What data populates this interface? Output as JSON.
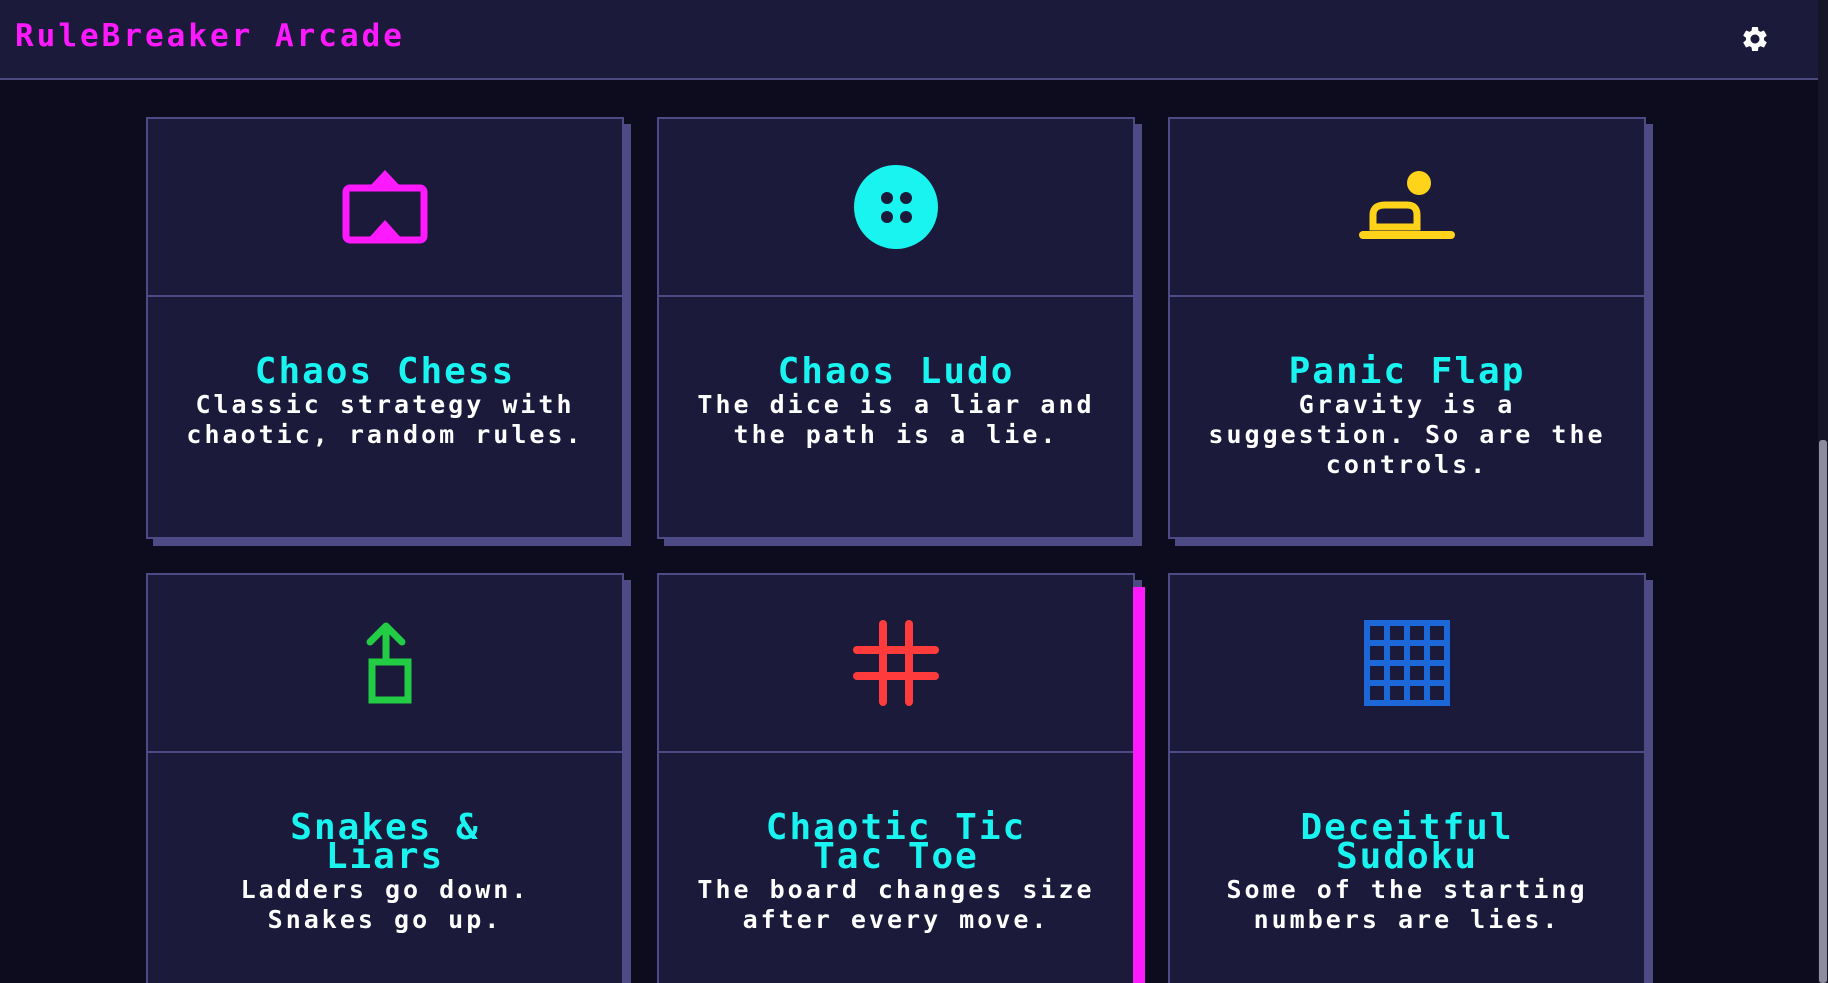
{
  "header": {
    "title": "RuleBreaker Arcade",
    "settings_icon": "gear-icon"
  },
  "colors": {
    "header_bg": "#1b1a3a",
    "page_bg": "#0c0c1e",
    "card_bg": "#1b1a3a",
    "border": "#4e4a86",
    "title_accent": "#ff19ff",
    "card_title": "#19f4f0",
    "card_desc": "#ffffff"
  },
  "games": [
    {
      "title": "Chaos Chess",
      "description": "Classic strategy with chaotic, random rules.",
      "icon": "chess-board-icon",
      "icon_color": "#ff19ff"
    },
    {
      "title": "Chaos Ludo",
      "description": "The dice is a liar and the path is a lie.",
      "icon": "dice-icon",
      "icon_color": "#19f4f0"
    },
    {
      "title": "Panic Flap",
      "description": "Gravity is a suggestion. So are the controls.",
      "icon": "flappy-bird-icon",
      "icon_color": "#ffd31a"
    },
    {
      "title": "Snakes & Liars",
      "description": "Ladders go down. Snakes go up.",
      "icon": "ladder-arrow-icon",
      "icon_color": "#22cc44"
    },
    {
      "title": "Chaotic Tic Tac Toe",
      "description": "The board changes size after every move.",
      "icon": "hash-grid-icon",
      "icon_color": "#ff3b3b"
    },
    {
      "title": "Deceitful Sudoku",
      "description": "Some of the starting numbers are lies.",
      "icon": "sudoku-grid-icon",
      "icon_color": "#1c68d8"
    }
  ]
}
